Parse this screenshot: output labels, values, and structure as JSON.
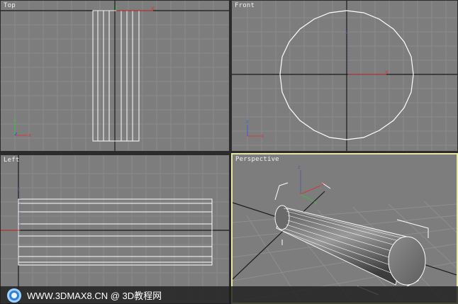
{
  "viewports": {
    "top": {
      "label": "Top",
      "axis_labels": {
        "x": "x",
        "y": "y"
      }
    },
    "front": {
      "label": "Front",
      "axis_labels": {
        "x": "x",
        "z": "z"
      }
    },
    "left": {
      "label": "Left",
      "axis_labels": {
        "y": "y",
        "z": "z"
      }
    },
    "perspective": {
      "label": "Perspective",
      "axis_labels": {
        "x": "x",
        "y": "y",
        "z": "z"
      }
    }
  },
  "watermark": {
    "text": "WWW.3DMAX8.CN @ 3D教程网"
  },
  "colors": {
    "viewport_bg": "#7d7d7d",
    "grid_line": "#8a8a8a",
    "home_grid": "#1a1a1a",
    "wire": "#ffffff",
    "active_border": "#e8e8a0",
    "axis_x": "#d23a3a",
    "axis_y": "#3fbf3f",
    "axis_z": "#3a5fd8"
  }
}
